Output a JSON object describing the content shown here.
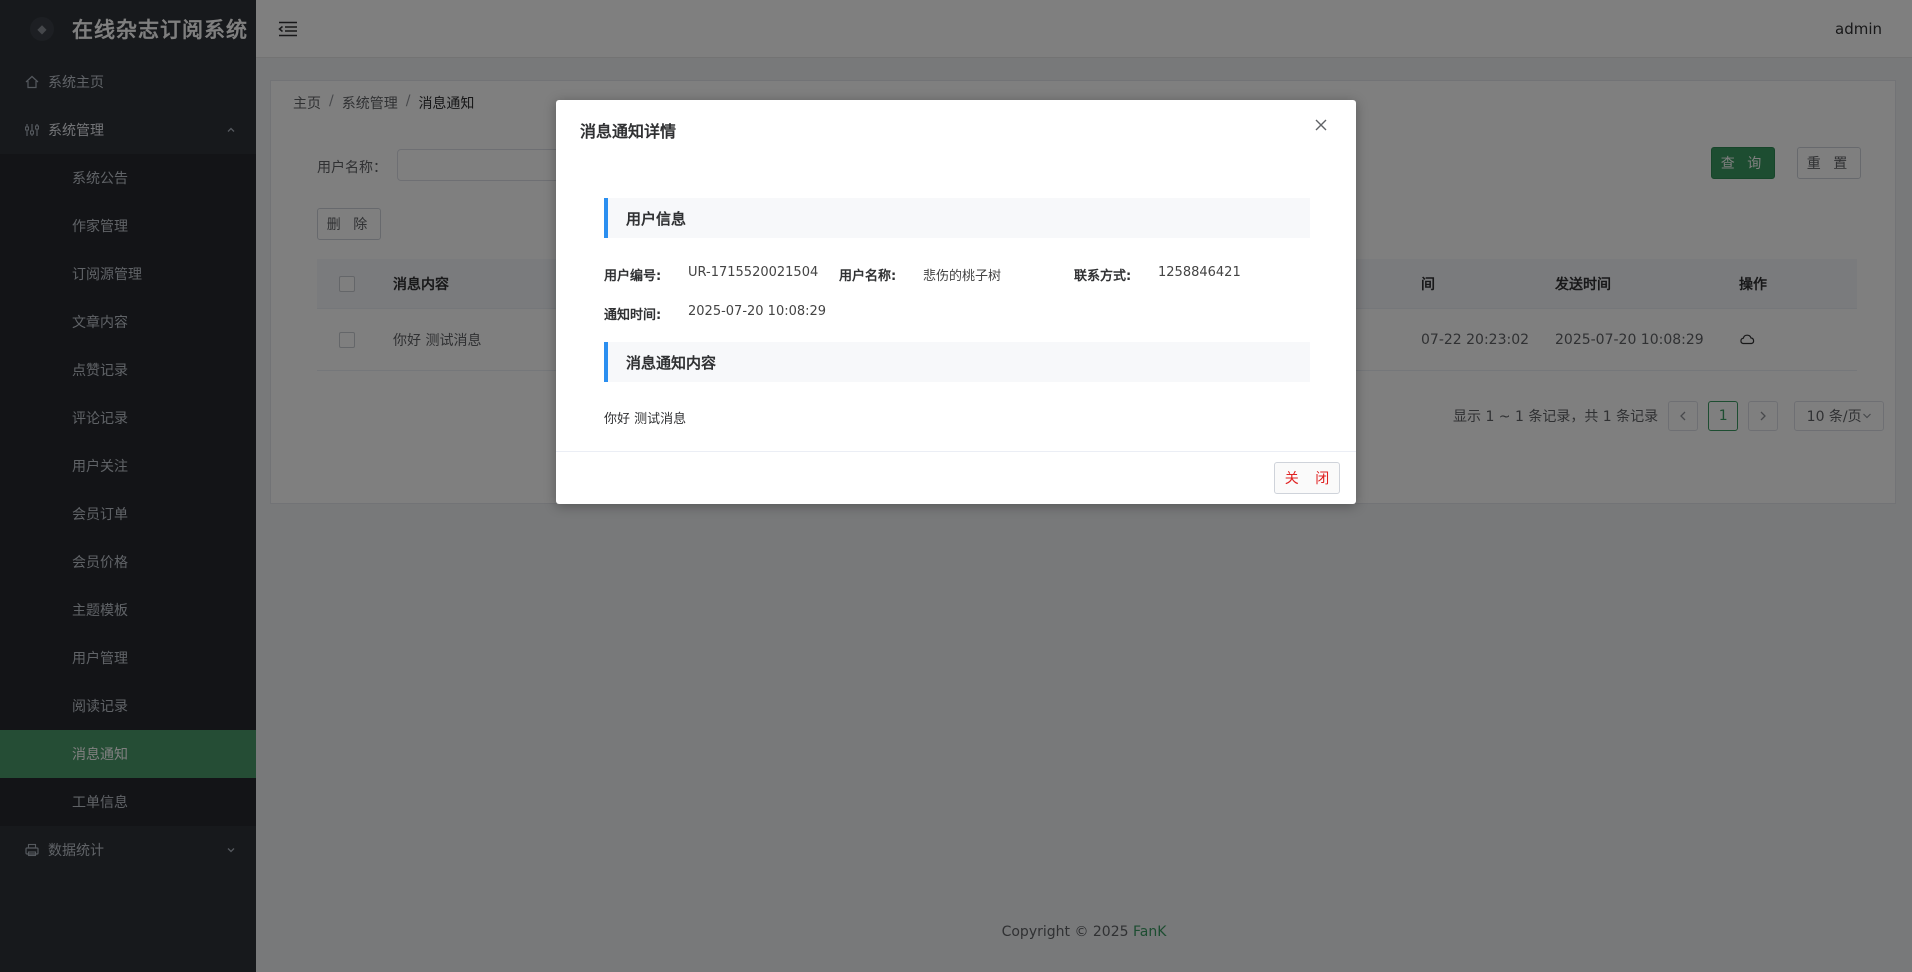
{
  "app": {
    "title": "在线杂志订阅系统",
    "user": "admin"
  },
  "sidebar": {
    "home": "系统主页",
    "system": "系统管理",
    "items": [
      "系统公告",
      "作家管理",
      "订阅源管理",
      "文章内容",
      "点赞记录",
      "评论记录",
      "用户关注",
      "会员订单",
      "会员价格",
      "主题模板",
      "用户管理",
      "阅读记录",
      "消息通知",
      "工单信息"
    ],
    "active_index": 12,
    "stats": "数据统计"
  },
  "breadcrumb": [
    "主页",
    "系统管理",
    "消息通知"
  ],
  "search": {
    "label": "用户名称：",
    "value": "",
    "query_label": "查 询",
    "reset_label": "重 置"
  },
  "toolbar": {
    "delete_label": "删 除"
  },
  "table": {
    "headers": [
      "消息内容",
      "间",
      "发送时间",
      "操作"
    ],
    "rows": [
      {
        "content": "你好 测试消息",
        "time1": "07-22 20:23:02",
        "send_time": "2025-07-20 10:08:29"
      }
    ]
  },
  "pagination": {
    "summary": "显示 1 ~ 1 条记录，共 1 条记录",
    "current": "1",
    "page_size": "10 条/页"
  },
  "footer": {
    "copyright": "Copyright © 2025",
    "brand": "FanK"
  },
  "modal": {
    "title": "消息通知详情",
    "section_user": "用户信息",
    "user_id_label": "用户编号:",
    "user_id": "UR-1715520021504",
    "user_name_label": "用户名称:",
    "user_name": "悲伤的桃子树",
    "contact_label": "联系方式:",
    "contact": "1258846421",
    "notify_time_label": "通知时间:",
    "notify_time": "2025-07-20 10:08:29",
    "section_content": "消息通知内容",
    "content": "你好 测试消息",
    "close_label": "关 闭"
  },
  "colors": {
    "accent": "#3b9b62",
    "sidebar_bg": "#2e3238",
    "section_bar": "#2b8ff0",
    "danger_text": "#e02020"
  }
}
